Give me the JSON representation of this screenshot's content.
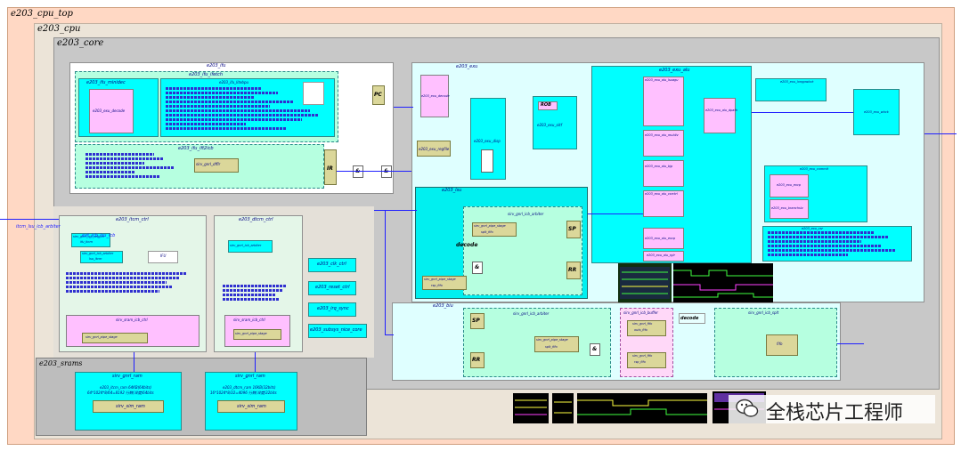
{
  "colors": {
    "outer_bg": "#ffd8c4",
    "cpu_bg": "#ece4d8",
    "core_bg": "#bdbdbd",
    "module": "#00ffff",
    "sub_module": "#ffc0ff",
    "fifo": "#dbd79a",
    "wire": "#2020ff"
  },
  "top": {
    "cpu_top": "e203_cpu_top",
    "cpu": "e203_cpu",
    "core": "e203_core"
  },
  "ifu": {
    "title": "e203_ifu",
    "ifetch": "e203_ifu_ifetch",
    "minidec": "e203_ifu_minidec",
    "exu_decode": "e203_exu_decode",
    "litebpu": "e203_ifu_litebpu",
    "ift2icb": "e203_ifu_ift2icb",
    "gnrl_dfflr": "sirv_gnrl_dfflr",
    "pc": "PC",
    "ir": "IR",
    "and1": "&",
    "and2": "&",
    "oitf": "e203_exu_oitf"
  },
  "exu": {
    "title": "e203_exu",
    "decode": "e203_exu_decode",
    "disp": "e203_exu_disp",
    "regfile": "e203_exu_regfile",
    "rob": "ROB",
    "rob_sub": "e203_exu_oitf",
    "alu": "e203_exu_alu",
    "alu_lsuagu": "e203_exu_alu_lsuagu",
    "alu_muldiv": "e203_exu_alu_muldiv",
    "alu_bjp": "e203_exu_alu_bjp",
    "alu_csrctrl": "e203_exu_alu_csrctrl",
    "alu_rglr": "e203_exu_alu_rglr",
    "alu_dpath": "e203_exu_alu_dpath",
    "alu_excp": "e203_exu_alu_excp",
    "longpwbck": "e203_exu_longpwbck",
    "wbck": "e203_exu_wbck",
    "commit": "e203_exu_commit",
    "commit_excp": "e203_exu_excp",
    "commit_branchslv": "e203_exu_branchslv",
    "csr": "e203_exu_csr"
  },
  "lsu": {
    "title": "e203_lsu",
    "ctrl": "e203_lsu_ctrl",
    "arbiter": "sirv_gnrl_icb_arbiter",
    "fifo1": "sirv_gnrl_pipe_stage",
    "fifo1_sub": "splt_fifo",
    "fifo2": "sirv_gnrl_pipe_stage",
    "fifo2_sub": "rsp_fifo",
    "decode": "decode",
    "sp": "SP",
    "rr": "RR",
    "and": "&"
  },
  "biu": {
    "title": "e203_biu",
    "arbiter": "sirv_gnrl_icb_arbiter",
    "pipe": "sirv_gnrl_pipe_stage",
    "pipe_sub": "splt_fifo",
    "buffer": "sirv_gnrl_icb_buffer",
    "buf_fifo1": "sirv_gnrl_fifo",
    "buf_fifo1_sub": "outs_fifo",
    "buf_fifo2": "sirv_gnrl_fifo",
    "buf_fifo2_sub": "rsp_fifo",
    "decode": "decode",
    "splt": "sirv_gnrl_icb_splt",
    "splt_fifo": "fifo",
    "sp": "SP",
    "rr": "RR",
    "and": "&"
  },
  "itcm": {
    "title": "e203_itcm_ctrl",
    "ifu2itcm": "sirv_gnrl_icb_arbiter",
    "ifu_arb": "sirv_gnrl_icb_arbiter",
    "ifu_arb_sub": "ifu_itcm",
    "lsu_arb": "sirv_gnrl_icb_arbiter",
    "lsu_arb_sub": "lsu_itcm",
    "sram_ctrl": "sirv_sram_icb_ctrl",
    "sram_ctrl_sub": "sirv_gnrl_pipe_stage",
    "red": "IFU"
  },
  "dtcm": {
    "title": "e203_dtcm_ctrl",
    "arb": "sirv_gnrl_icb_arbiter",
    "sram_ctrl": "sirv_sram_icb_ctrl",
    "sram_ctrl_sub": "sirv_gnrl_pipe_stage"
  },
  "misc": {
    "clk_ctrl": "e203_clk_ctrl",
    "reset_ctrl": "e203_reset_ctrl",
    "irq_sync": "e203_irq_sync",
    "extend_csr": "e203_subsys_nice_core"
  },
  "srams": {
    "title": "e203_srams",
    "itcm_ram": "sirv_gnrl_ram",
    "itcm_ram_desc": "e203_itcm_ram  64KB(64bits)",
    "itcm_ram_desc2": "64*1024*8/64=8192 行数(深度)64bits",
    "itcm_ram_inner": "sirv_sim_ram",
    "dtcm_ram": "sirv_gnrl_ram",
    "dtcm_ram_desc": "e203_dtcm_ram  16KB(32bits)",
    "dtcm_ram_desc2": "16*1024*8/32=4096 行数(深度)32bits",
    "dtcm_ram_inner": "sirv_sim_ram"
  },
  "side": {
    "left_note": "itcm_lsu_icb_arbiter",
    "left_note2": "ext_icb_lsu_icb"
  },
  "watermark": "全栈芯片工程师"
}
